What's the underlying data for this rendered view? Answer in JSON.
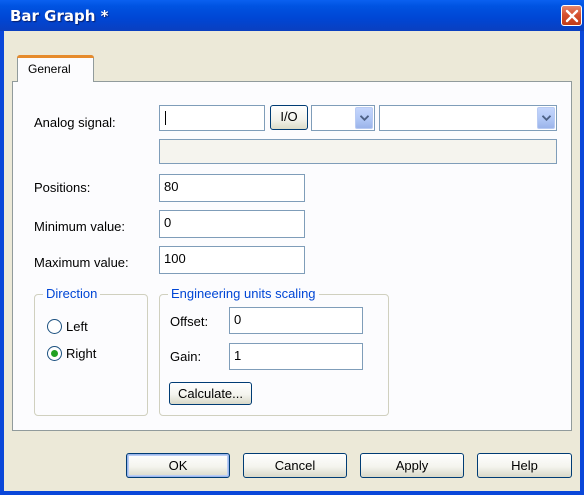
{
  "window": {
    "title": "Bar Graph *"
  },
  "tabs": [
    {
      "label": "General"
    }
  ],
  "form": {
    "analog_signal": {
      "label": "Analog signal:",
      "value": "",
      "io_label": "I/O",
      "select1_value": "",
      "select2_value": "",
      "description": ""
    },
    "positions": {
      "label": "Positions:",
      "value": "80"
    },
    "minimum_value": {
      "label": "Minimum value:",
      "value": "0"
    },
    "maximum_value": {
      "label": "Maximum value:",
      "value": "100"
    }
  },
  "direction": {
    "title": "Direction",
    "options": [
      {
        "label": "Left",
        "checked": false
      },
      {
        "label": "Right",
        "checked": true
      }
    ]
  },
  "scaling": {
    "title": "Engineering units scaling",
    "offset": {
      "label": "Offset:",
      "value": "0"
    },
    "gain": {
      "label": "Gain:",
      "value": "1"
    },
    "calculate_label": "Calculate..."
  },
  "buttons": {
    "ok": "OK",
    "cancel": "Cancel",
    "apply": "Apply",
    "help": "Help"
  },
  "colors": {
    "titlebar": "#0046d4",
    "group_title": "#0046d5",
    "tab_highlight": "#e68b2c"
  }
}
